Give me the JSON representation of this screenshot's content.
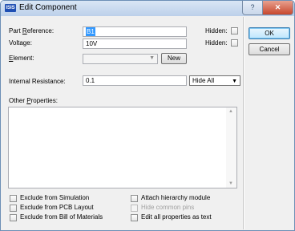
{
  "window": {
    "title": "Edit Component",
    "icon_text": "ISIS",
    "icon": "isis-app-icon",
    "help_glyph": "?",
    "close_glyph": "✕"
  },
  "form": {
    "part_reference": {
      "label_pre": "Part ",
      "label_acc": "R",
      "label_post": "eference:",
      "value": "B1",
      "hidden_label": "Hidden:"
    },
    "voltage": {
      "label": "Voltage:",
      "value": "10V",
      "hidden_label": "Hidden:"
    },
    "element": {
      "label_acc": "E",
      "label_post": "lement:",
      "value": "",
      "new_label": "New"
    },
    "internal_resistance": {
      "label": "Internal Resistance:",
      "value": "0.1",
      "visibility": "Hide All"
    },
    "other_properties": {
      "label_pre": "Other ",
      "label_acc": "P",
      "label_post": "roperties:",
      "value": ""
    }
  },
  "buttons": {
    "ok": "OK",
    "cancel": "Cancel"
  },
  "checkboxes": {
    "exclude_simulation": "Exclude from Simulation",
    "exclude_pcb": "Exclude from PCB Layout",
    "exclude_bom": "Exclude from Bill of Materials",
    "attach_hierarchy": "Attach hierarchy module",
    "hide_common_pins": "Hide common pins",
    "edit_all_text": "Edit all properties as text"
  }
}
